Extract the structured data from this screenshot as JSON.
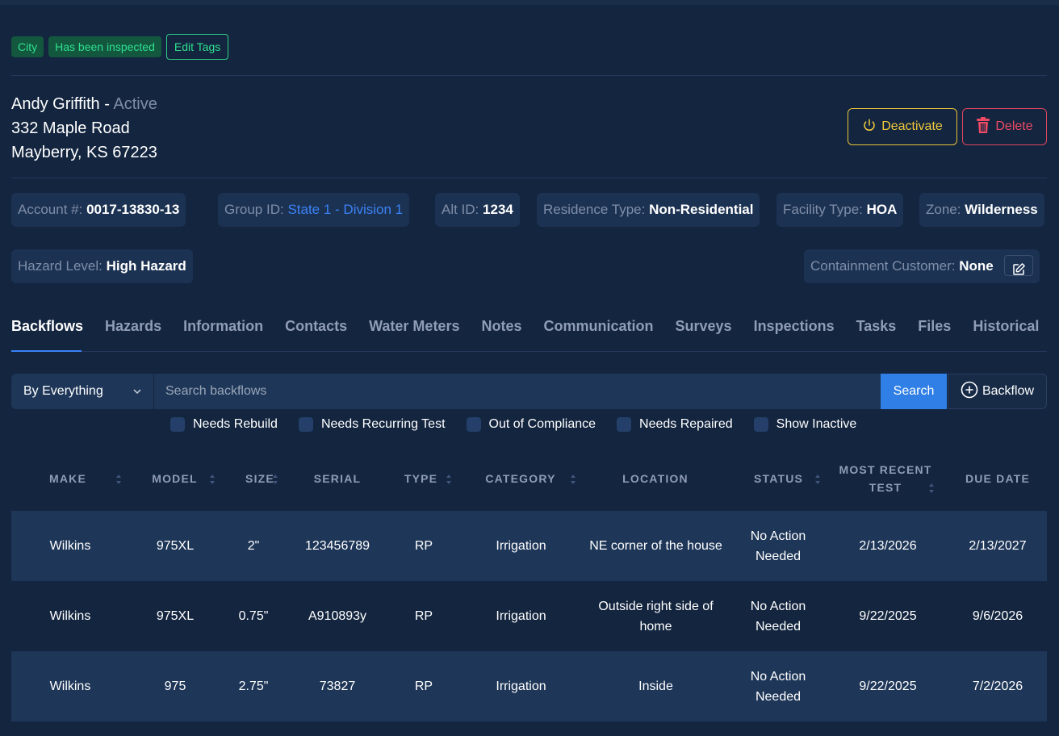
{
  "tags": {
    "items": [
      "City",
      "Has been inspected"
    ],
    "edit_label": "Edit Tags"
  },
  "customer": {
    "name": "Andy Griffith",
    "separator": " - ",
    "status": "Active",
    "address_line1": "332 Maple Road",
    "address_line2": "Mayberry, KS 67223"
  },
  "actions": {
    "deactivate_label": "Deactivate",
    "delete_label": "Delete"
  },
  "info": {
    "account_label": "Account #:",
    "account_value": "0017-13830-13",
    "group_label": "Group ID:",
    "group_value": "State 1 - Division 1",
    "alt_label": "Alt ID:",
    "alt_value": "1234",
    "residence_label": "Residence Type:",
    "residence_value": "Non-Residential",
    "facility_label": "Facility Type:",
    "facility_value": "HOA",
    "zone_label": "Zone:",
    "zone_value": "Wilderness",
    "hazard_label": "Hazard Level:",
    "hazard_value": "High Hazard",
    "containment_label": "Containment Customer:",
    "containment_value": "None"
  },
  "tabs": [
    "Backflows",
    "Hazards",
    "Information",
    "Contacts",
    "Water Meters",
    "Notes",
    "Communication",
    "Surveys",
    "Inspections",
    "Tasks",
    "Files",
    "Historical"
  ],
  "active_tab": "Backflows",
  "search": {
    "filter_value": "By Everything",
    "placeholder": "Search backflows",
    "search_label": "Search",
    "add_label": "Backflow"
  },
  "filters": [
    "Needs Rebuild",
    "Needs Recurring Test",
    "Out of Compliance",
    "Needs Repaired",
    "Show Inactive"
  ],
  "table": {
    "headers": [
      "MAKE",
      "MODEL",
      "SIZE",
      "SERIAL",
      "TYPE",
      "CATEGORY",
      "LOCATION",
      "STATUS",
      "MOST RECENT TEST",
      "DUE DATE"
    ],
    "rows": [
      [
        "Wilkins",
        "975XL",
        "2\"",
        "123456789",
        "RP",
        "Irrigation",
        "NE corner of the house",
        "No Action Needed",
        "2/13/2026",
        "2/13/2027"
      ],
      [
        "Wilkins",
        "975XL",
        "0.75\"",
        "A910893y",
        "RP",
        "Irrigation",
        "Outside right side of home",
        "No Action Needed",
        "9/22/2025",
        "9/6/2026"
      ],
      [
        "Wilkins",
        "975",
        "2.75\"",
        "73827",
        "RP",
        "Irrigation",
        "Inside",
        "No Action Needed",
        "9/22/2025",
        "7/2/2026"
      ]
    ]
  },
  "colors": {
    "background": "#13253f",
    "panel": "#1e3658",
    "tag_green": "#2fe08f",
    "deactivate": "#f0c93c",
    "delete": "#f04a64",
    "link": "#3b82f6",
    "primary_button": "#2f7fe6"
  }
}
